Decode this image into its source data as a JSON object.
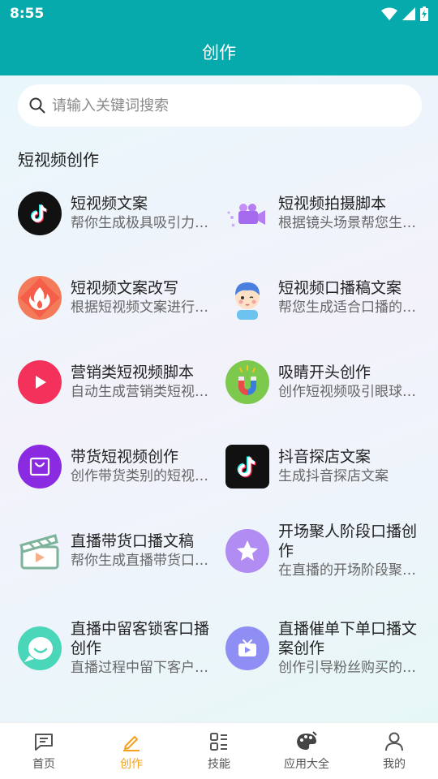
{
  "status_bar": {
    "time": "8:55"
  },
  "header": {
    "title": "创作"
  },
  "search": {
    "placeholder": "请输入关键词搜索"
  },
  "section": {
    "title": "短视频创作"
  },
  "cards": [
    {
      "title": "短视频文案",
      "desc": "帮你生成极具吸引力的短视频文案",
      "icon": "tiktok-icon"
    },
    {
      "title": "短视频拍摄脚本",
      "desc": "根据镜头场景帮您生成拍摄脚本",
      "icon": "video-camera-icon"
    },
    {
      "title": "短视频文案改写",
      "desc": "根据短视频文案进行改写",
      "icon": "flame-icon"
    },
    {
      "title": "短视频口播稿文案",
      "desc": "帮您生成适合口播的文案",
      "icon": "boy-avatar-icon"
    },
    {
      "title": "营销类短视频脚本",
      "desc": "自动生成营销类短视频脚本",
      "icon": "play-icon"
    },
    {
      "title": "吸睛开头创作",
      "desc": "创作短视频吸引眼球的开头",
      "icon": "magnet-icon"
    },
    {
      "title": "带货短视频创作",
      "desc": "创作带货类别的短视频文案",
      "icon": "shopping-bag-icon"
    },
    {
      "title": "抖音探店文案",
      "desc": "生成抖音探店文案",
      "icon": "douyin-icon"
    },
    {
      "title": "直播带货口播文稿",
      "desc": "帮你生成直播带货口播文稿",
      "icon": "clapperboard-icon"
    },
    {
      "title": "开场聚人阶段口播创作",
      "desc": "在直播的开场阶段聚集人气",
      "icon": "star-icon"
    },
    {
      "title": "直播中留客锁客口播创作",
      "desc": "直播过程中留下客户的口播",
      "icon": "chat-bubble-icon"
    },
    {
      "title": "直播催单下单口播文案创作",
      "desc": "创作引导粉丝购买的口播文案",
      "icon": "tv-icon"
    }
  ],
  "bottom_nav": [
    {
      "label": "首页",
      "icon": "message-square-icon",
      "active": false
    },
    {
      "label": "创作",
      "icon": "pencil-icon",
      "active": true
    },
    {
      "label": "技能",
      "icon": "list-grid-icon",
      "active": false
    },
    {
      "label": "应用大全",
      "icon": "palette-icon",
      "active": false
    },
    {
      "label": "我的",
      "icon": "user-icon",
      "active": false
    }
  ],
  "colors": {
    "primary": "#07aaac",
    "active_nav": "#f5a11c"
  }
}
